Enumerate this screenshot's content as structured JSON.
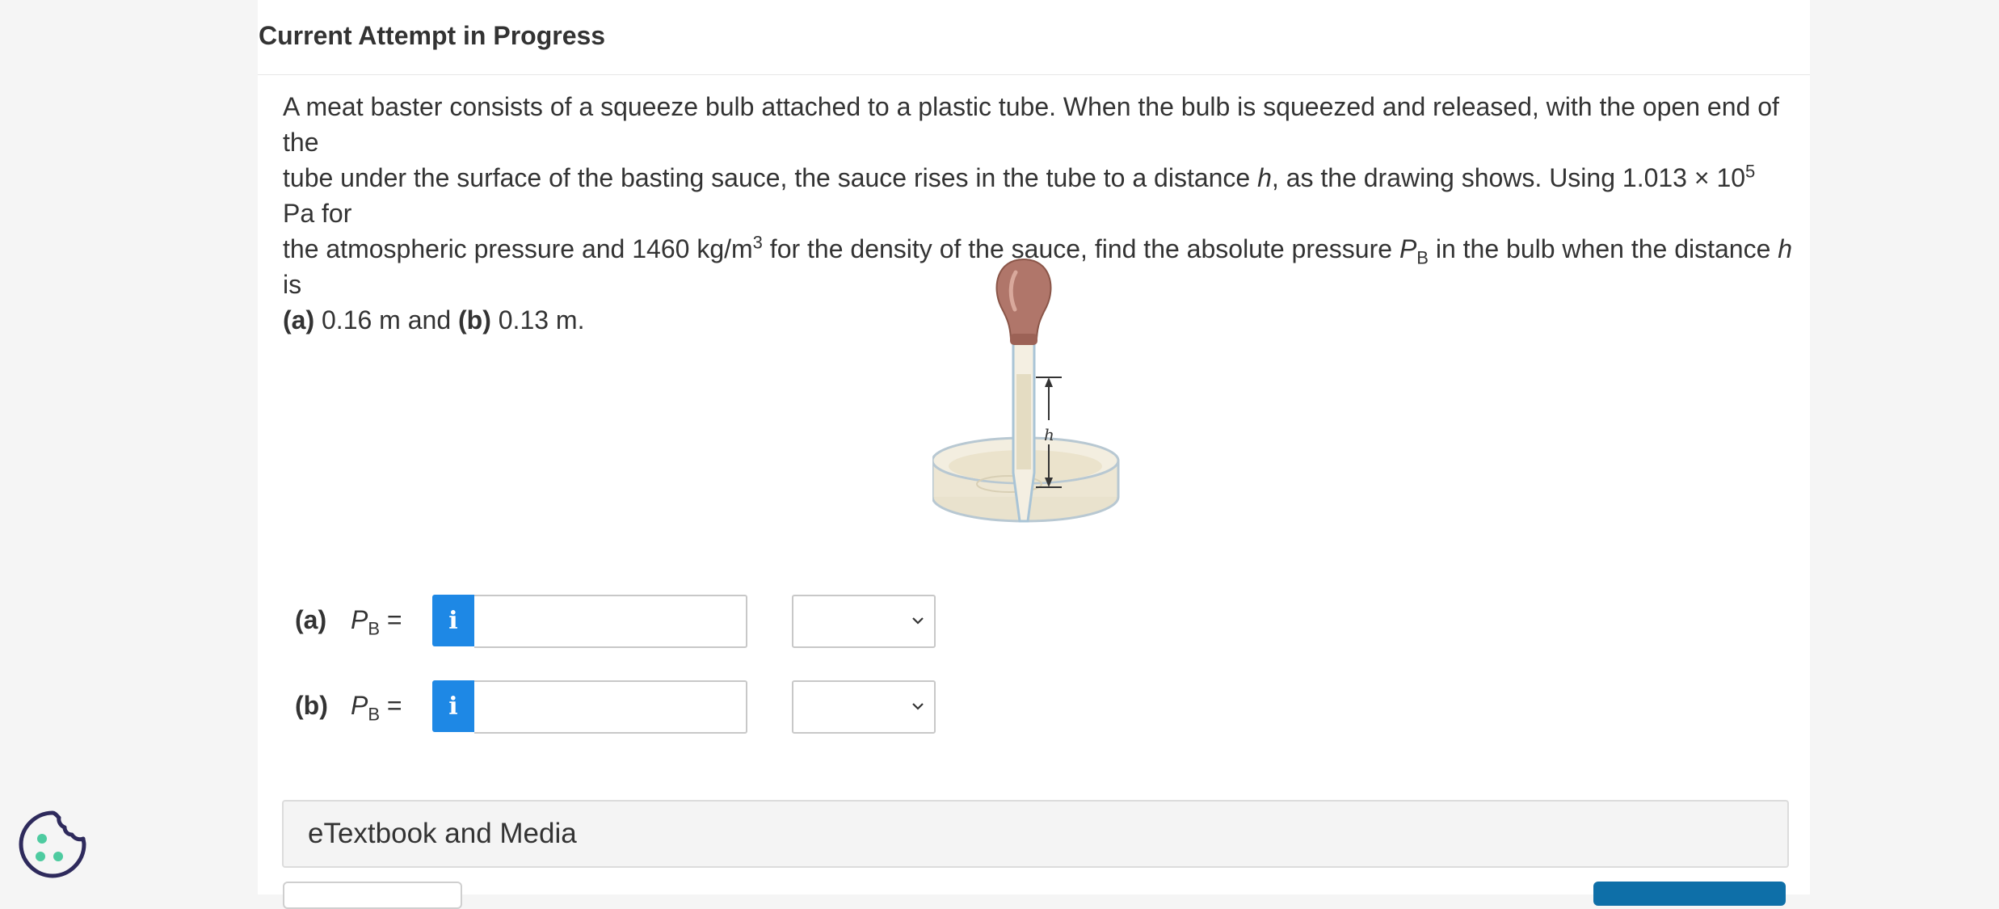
{
  "header": {
    "title": "Current Attempt in Progress"
  },
  "question": {
    "line1": "A meat baster consists of a squeeze bulb attached to a plastic tube. When the bulb is squeezed and released, with the open end of the",
    "line2_a": "tube under the surface of the basting sauce, the sauce rises in the tube to a distance ",
    "line2_h": "h",
    "line2_b": ", as the drawing shows. Using 1.013 × 10",
    "line2_exp": "5",
    "line2_c": " Pa for",
    "line3_a": "the atmospheric pressure and 1460 kg/m",
    "line3_exp": "3",
    "line3_b": " for the density of the sauce, find the absolute pressure ",
    "line3_P": "P",
    "line3_sub": "B",
    "line3_c": " in the bulb when the distance ",
    "line3_h": "h",
    "line3_d": " is",
    "line4_a_label": "(a)",
    "line4_a_val": " 0.16 m and ",
    "line4_b_label": "(b)",
    "line4_b_val": " 0.13 m."
  },
  "figure": {
    "h_label": "h",
    "colors": {
      "bulb": "#b0766a",
      "sauce": "#ede6d3",
      "glass": "#a9c4d6",
      "arrow": "#333333"
    }
  },
  "answers": [
    {
      "part": "(a)",
      "var": "P",
      "sub": "B",
      "eq": " =",
      "info_icon": "i",
      "value": "",
      "unit_selected": ""
    },
    {
      "part": "(b)",
      "var": "P",
      "sub": "B",
      "eq": " =",
      "info_icon": "i",
      "value": "",
      "unit_selected": ""
    }
  ],
  "etextbook": {
    "label": "eTextbook and Media"
  },
  "colors": {
    "accent": "#1e88e5",
    "cookie_icon": "#2e2a5c",
    "cookie_dots": "#4ecba0"
  }
}
